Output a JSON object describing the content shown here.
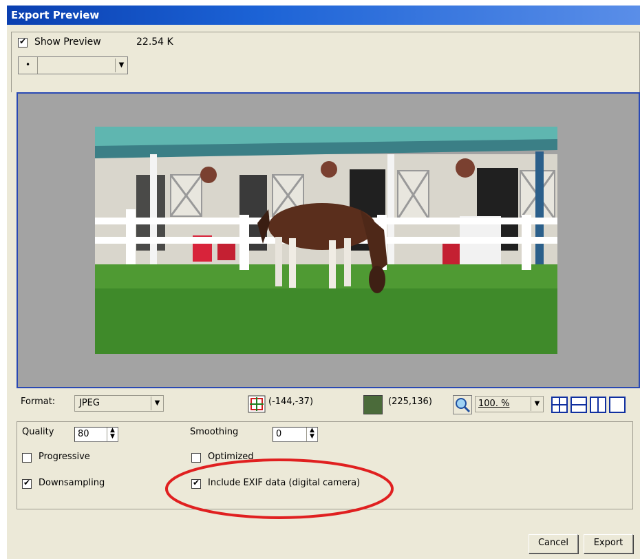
{
  "window": {
    "title": "Export Preview"
  },
  "top": {
    "show_preview_label": "Show Preview",
    "show_preview_checked": true,
    "file_size": "22.54 K"
  },
  "info_bar": {
    "format_label": "Format:",
    "format_value": "JPEG",
    "cursor_coords": "(-144,-37)",
    "color_coords": "(225,136)",
    "sample_color": "#4b6b3a",
    "zoom_value": "100. %"
  },
  "options": {
    "quality_label": "Quality",
    "quality_value": "80",
    "smoothing_label": "Smoothing",
    "smoothing_value": "0",
    "progressive_label": "Progressive",
    "progressive_checked": false,
    "optimized_label": "Optimized",
    "optimized_checked": false,
    "downsampling_label": "Downsampling",
    "downsampling_checked": true,
    "exif_label": "Include EXIF data (digital camera)",
    "exif_checked": true
  },
  "buttons": {
    "cancel": "Cancel",
    "export": "Export"
  },
  "colors": {
    "highlight_circle": "#e02020",
    "title_bar": "#1c63d6",
    "preview_border": "#2a49b4"
  },
  "icons": [
    "crop-icon",
    "magnifier-icon",
    "view-grid-icon",
    "view-split-horizontal-icon",
    "view-split-vertical-icon",
    "view-single-icon"
  ]
}
